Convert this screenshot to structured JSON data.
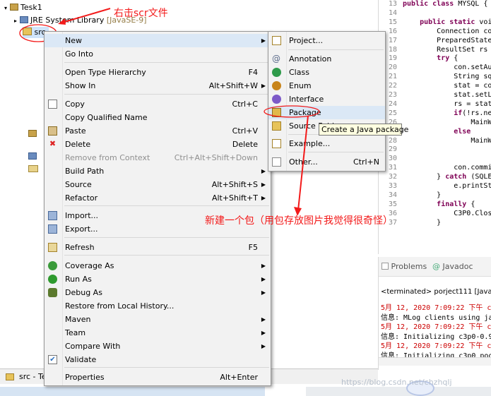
{
  "tree": {
    "project": "Tesk1",
    "jre": "JRE System Library",
    "jre_suffix": "[JavaSE-9]",
    "src": "src"
  },
  "statusbar": {
    "label": "src - Te"
  },
  "annotations": {
    "right_click": "右击scr文件",
    "new_package": "新建一个包（用包存放图片我觉得很奇怪）"
  },
  "context_menu": {
    "items": [
      {
        "label": "New",
        "shortcut": "",
        "submenu": true
      },
      {
        "label": "Go Into",
        "shortcut": ""
      },
      {
        "label": "Open Type Hierarchy",
        "shortcut": "F4"
      },
      {
        "label": "Show In",
        "shortcut": "Alt+Shift+W",
        "submenu": true
      },
      {
        "label": "Copy",
        "shortcut": "Ctrl+C"
      },
      {
        "label": "Copy Qualified Name",
        "shortcut": ""
      },
      {
        "label": "Paste",
        "shortcut": "Ctrl+V"
      },
      {
        "label": "Delete",
        "shortcut": "Delete"
      },
      {
        "label": "Remove from Context",
        "shortcut": "Ctrl+Alt+Shift+Down"
      },
      {
        "label": "Build Path",
        "shortcut": "",
        "submenu": true
      },
      {
        "label": "Source",
        "shortcut": "Alt+Shift+S",
        "submenu": true
      },
      {
        "label": "Refactor",
        "shortcut": "Alt+Shift+T",
        "submenu": true
      },
      {
        "label": "Import...",
        "shortcut": ""
      },
      {
        "label": "Export...",
        "shortcut": ""
      },
      {
        "label": "Refresh",
        "shortcut": "F5"
      },
      {
        "label": "Coverage As",
        "shortcut": "",
        "submenu": true
      },
      {
        "label": "Run As",
        "shortcut": "",
        "submenu": true
      },
      {
        "label": "Debug As",
        "shortcut": "",
        "submenu": true
      },
      {
        "label": "Restore from Local History...",
        "shortcut": ""
      },
      {
        "label": "Maven",
        "shortcut": "",
        "submenu": true
      },
      {
        "label": "Team",
        "shortcut": "",
        "submenu": true
      },
      {
        "label": "Compare With",
        "shortcut": "",
        "submenu": true
      },
      {
        "label": "Validate",
        "shortcut": ""
      },
      {
        "label": "Properties",
        "shortcut": "Alt+Enter"
      }
    ]
  },
  "submenu": {
    "items": [
      {
        "label": "Project...",
        "shortcut": ""
      },
      {
        "label": "Annotation",
        "shortcut": ""
      },
      {
        "label": "Class",
        "shortcut": ""
      },
      {
        "label": "Enum",
        "shortcut": ""
      },
      {
        "label": "Interface",
        "shortcut": ""
      },
      {
        "label": "Package",
        "shortcut": ""
      },
      {
        "label": "Source Fold",
        "shortcut": ""
      },
      {
        "label": "Example...",
        "shortcut": ""
      },
      {
        "label": "Other...",
        "shortcut": "Ctrl+N"
      }
    ],
    "tooltip": "Create a Java package"
  },
  "code": {
    "lines": [
      {
        "n": "13",
        "t": "public class MYSQL {"
      },
      {
        "n": "14",
        "t": ""
      },
      {
        "n": "15",
        "t": "    public static voi"
      },
      {
        "n": "16",
        "t": "        Connection con"
      },
      {
        "n": "17",
        "t": "        PreparedState"
      },
      {
        "n": "18",
        "t": "        ResultSet rs"
      },
      {
        "n": "19",
        "t": "        try {"
      },
      {
        "n": "20",
        "t": "            con.setAu"
      },
      {
        "n": "21",
        "t": "            String sq"
      },
      {
        "n": "22",
        "t": "            stat = co"
      },
      {
        "n": "23",
        "t": "            stat.setL"
      },
      {
        "n": "24",
        "t": "            rs = stat"
      },
      {
        "n": "25",
        "t": "            if(!rs.ne"
      },
      {
        "n": "26",
        "t": "                MainW"
      },
      {
        "n": "27",
        "t": "            else"
      },
      {
        "n": "28",
        "t": "                MainW"
      },
      {
        "n": "29",
        "t": ""
      },
      {
        "n": "30",
        "t": ""
      },
      {
        "n": "31",
        "t": "            con.commi"
      },
      {
        "n": "32",
        "t": "        } catch (SQLE"
      },
      {
        "n": "33",
        "t": "            e.printSt"
      },
      {
        "n": "34",
        "t": "        }"
      },
      {
        "n": "35",
        "t": "        finally {"
      },
      {
        "n": "36",
        "t": "            C3P0.Clos"
      },
      {
        "n": "37",
        "t": "        }"
      }
    ]
  },
  "console": {
    "tabs": [
      "Problems",
      "Javadoc"
    ],
    "header": "<terminated> porject111 [Java",
    "lines": [
      {
        "t": "5月 12, 2020 7:09:22 下午 co",
        "red": true
      },
      {
        "t": "信息: MLog clients using ja",
        "red": false
      },
      {
        "t": "5月 12, 2020 7:09:22 下午 co",
        "red": true
      },
      {
        "t": "信息: Initializing c3p0-0.9",
        "red": false
      },
      {
        "t": "5月 12, 2020 7:09:22 下午 co",
        "red": true
      },
      {
        "t": "信息: Initializing c3p0 poo",
        "red": false
      }
    ]
  },
  "watermark": "https://blog.csdn.net/chzhqlj",
  "colors": {
    "annotation": "#f31a1a",
    "menu_bg": "#f2f2f2",
    "highlight": "#dbe8f6"
  }
}
